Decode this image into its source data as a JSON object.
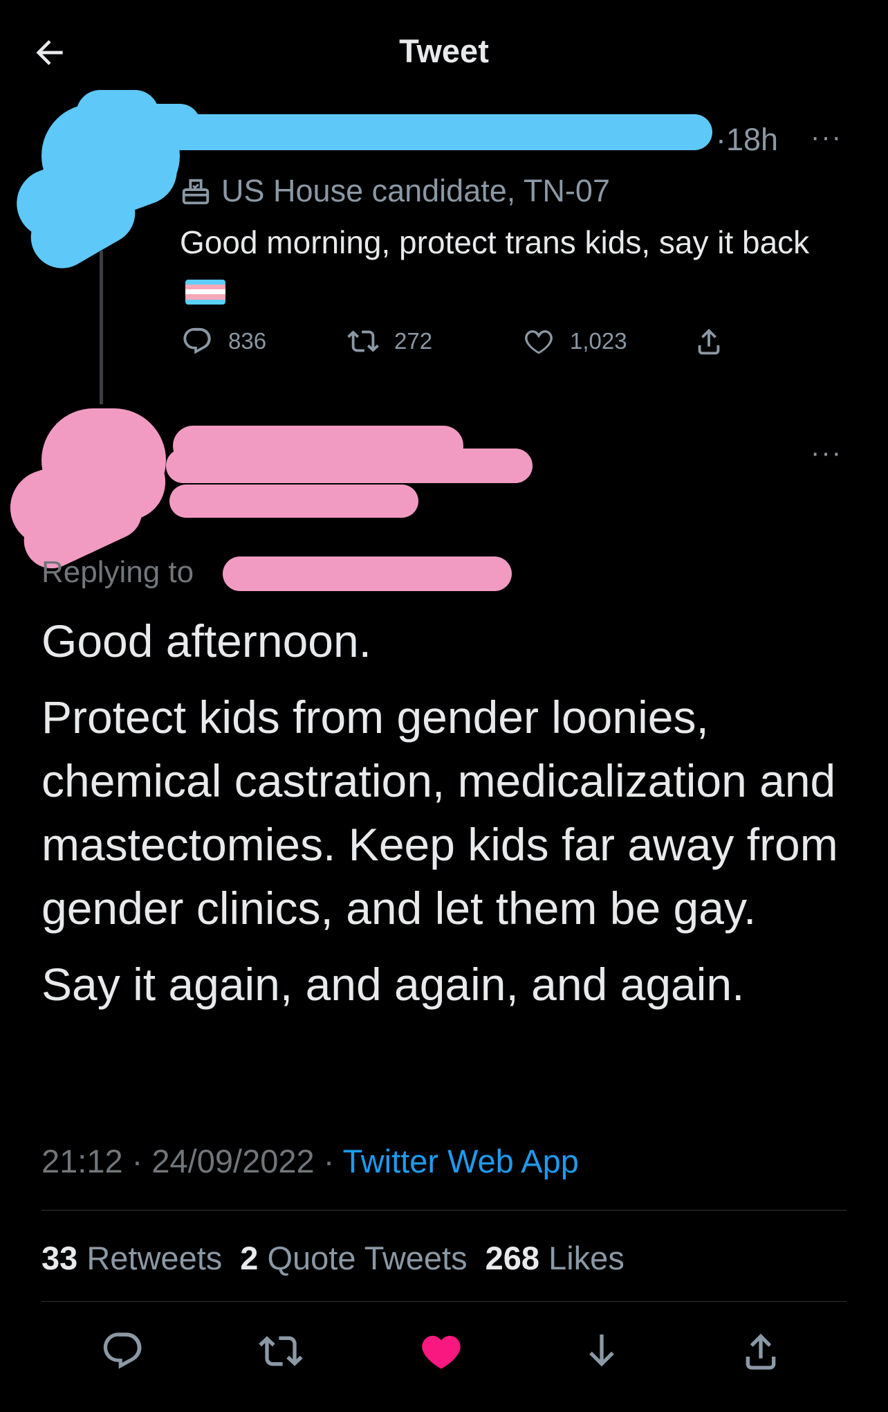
{
  "header": {
    "title": "Tweet",
    "back_icon": "arrow-left-icon"
  },
  "parent_tweet": {
    "time": "18h",
    "more": "···",
    "label_icon": "ballot-box-icon",
    "label": "US House candidate, TN-07",
    "text": "Good morning, protect trans kids, say it back",
    "flag_emoji": "transgender-flag",
    "replies": "836",
    "retweets": "272",
    "likes": "1,023"
  },
  "reply_tweet": {
    "more": "···",
    "replying_to": "Replying to",
    "paragraphs": [
      "Good afternoon.",
      "Protect kids from gender loonies, chemical castration, medicalization and mastectomies. Keep kids far away from gender clinics, and let them be gay.",
      "Say it again, and again, and again."
    ],
    "time": "21:12",
    "date": "24/09/2022",
    "source": "Twitter Web App",
    "retweets_count": "33",
    "retweets_label": "Retweets",
    "quotes_count": "2",
    "quotes_label": "Quote Tweets",
    "likes_count": "268",
    "likes_label": "Likes"
  },
  "colors": {
    "background": "#000000",
    "redact_blue": "#5ec8f8",
    "redact_pink": "#f29bc2",
    "link": "#1d9bf0",
    "like_active": "#f91880"
  }
}
